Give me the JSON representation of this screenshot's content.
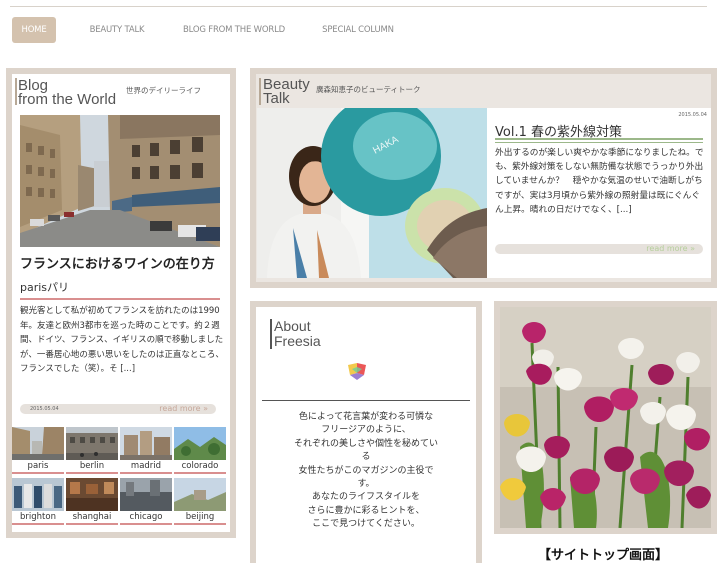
{
  "nav": {
    "tabs": [
      {
        "label": "HOME",
        "active": true
      },
      {
        "label": "BEAUTY TALK",
        "active": false
      },
      {
        "label": "BLOG FROM THE WORLD",
        "active": false
      },
      {
        "label": "SPECIAL COLUMN",
        "active": false
      }
    ]
  },
  "blog": {
    "heading_line1": "Blog",
    "heading_line2": "from the World",
    "subheading": "世界のデイリーライフ",
    "post_title": "フランスにおけるワインの在り方",
    "location": "parisパリ",
    "excerpt": "観光客として私が初めてフランスを訪れたのは1990年。友達と欧州3都市を巡った時のことです。約２週間、ドイツ、フランス、イギリスの順で移動しましたが、一番居心地の悪い思いをしたのは正直なところ、フランスでした（笑）。そ [...]",
    "date": "2015.05.04",
    "read_more": "read more »",
    "cities": [
      "paris",
      "berlin",
      "madrid",
      "colorado",
      "brighton",
      "shanghai",
      "chicago",
      "beijing"
    ]
  },
  "beauty": {
    "heading_line1": "Beauty",
    "heading_line2": "Talk",
    "subheading": "廣森知恵子のビューティトーク",
    "date": "2015.05.04",
    "post_title": "Vol.1 春の紫外線対策",
    "excerpt": "外出するのが楽しい爽やかな季節になりましたね。でも、紫外線対策をしない無防備な状態でうっかり外出していませんか？　穏やかな気温のせいで油断しがちですが、実は3月頃から紫外線の照射量は既にぐんぐん上昇。晴れの日だけでなく、[...]",
    "read_more": "read more »",
    "compact_brand": "HAKA"
  },
  "about": {
    "heading_line1": "About",
    "heading_line2": "Freesia",
    "lines": [
      "色によって花言葉が変わる可憐な",
      "フリージアのように、",
      "それぞれの美しさや個性を秘めてい",
      "る",
      "女性たちがこのマガジンの主役で",
      "す。",
      "あなたのライフスタイルを",
      "さらに豊かに彩るヒントを、",
      "ここで見つけてください。"
    ]
  },
  "caption": "【サイトトップ画面】",
  "colors": {
    "frame": "#ddd4cb",
    "active_tab": "#d4c2ae",
    "accent_red": "#d98f8f",
    "accent_green": "#9cb88a",
    "read_more_text": "#c7a89a"
  },
  "icons": [
    "freesia-logo-icon"
  ]
}
